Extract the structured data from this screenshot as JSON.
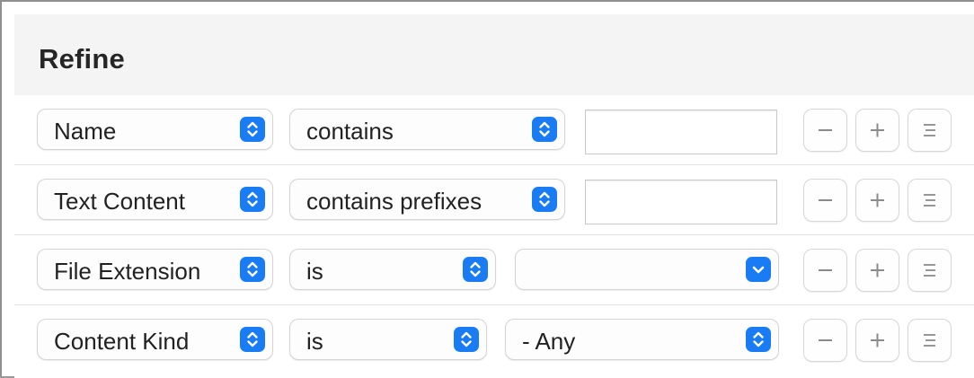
{
  "header": {
    "title": "Refine"
  },
  "rows": [
    {
      "attribute": "Name",
      "operator": "contains",
      "value_type": "text",
      "value": ""
    },
    {
      "attribute": "Text Content",
      "operator": "contains prefixes",
      "value_type": "text",
      "value": ""
    },
    {
      "attribute": "File Extension",
      "operator": "is",
      "value_type": "dropdown",
      "value": ""
    },
    {
      "attribute": "Content Kind",
      "operator": "is",
      "value_type": "popup",
      "value": "- Any"
    }
  ],
  "icons": {
    "popup_arrows": "chevron-up-down-icon",
    "dropdown_arrow": "chevron-down-icon",
    "remove": "minus-icon",
    "add": "plus-icon",
    "more": "lines-icon"
  },
  "colors": {
    "accent": "#1a7cf5",
    "header_bg": "#f4f4f4"
  }
}
